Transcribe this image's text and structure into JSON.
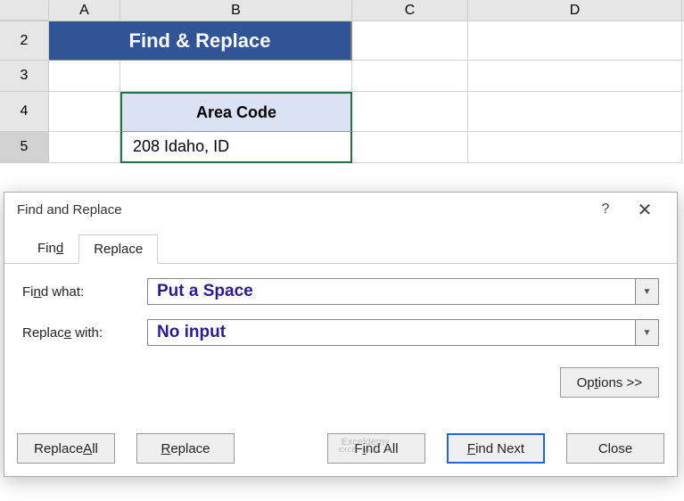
{
  "columns": {
    "A": "A",
    "B": "B",
    "C": "C",
    "D": "D"
  },
  "rows": {
    "r2": "2",
    "r3": "3",
    "r4": "4",
    "r5": "5"
  },
  "banner": "Find & Replace",
  "header_b4": "Area Code",
  "cell_b5": "208  Idaho,     ID",
  "dialog": {
    "title": "Find and Replace",
    "help": "?",
    "close": "✕",
    "tab_find": "Find",
    "tab_find_u": "d",
    "tab_replace": "Replace",
    "tab_replace_u": "R",
    "find_what": "Find what:",
    "find_what_u": "n",
    "replace_with": "Replace with:",
    "replace_with_u": "e",
    "find_input": "Put a Space",
    "replace_input": "No input",
    "options": "Options >>",
    "options_u": "O",
    "btn_replace_all": "Replace All",
    "btn_replace_all_u": "A",
    "btn_replace": "Replace",
    "btn_replace_u": "R",
    "btn_find_all": "Find All",
    "btn_find_all_u": "I",
    "btn_find_next": "Find Next",
    "btn_find_next_u": "F",
    "btn_close": "Close"
  },
  "watermark": {
    "line1": "Exceldemy",
    "line2": "EXCEL · DATA · BI"
  }
}
